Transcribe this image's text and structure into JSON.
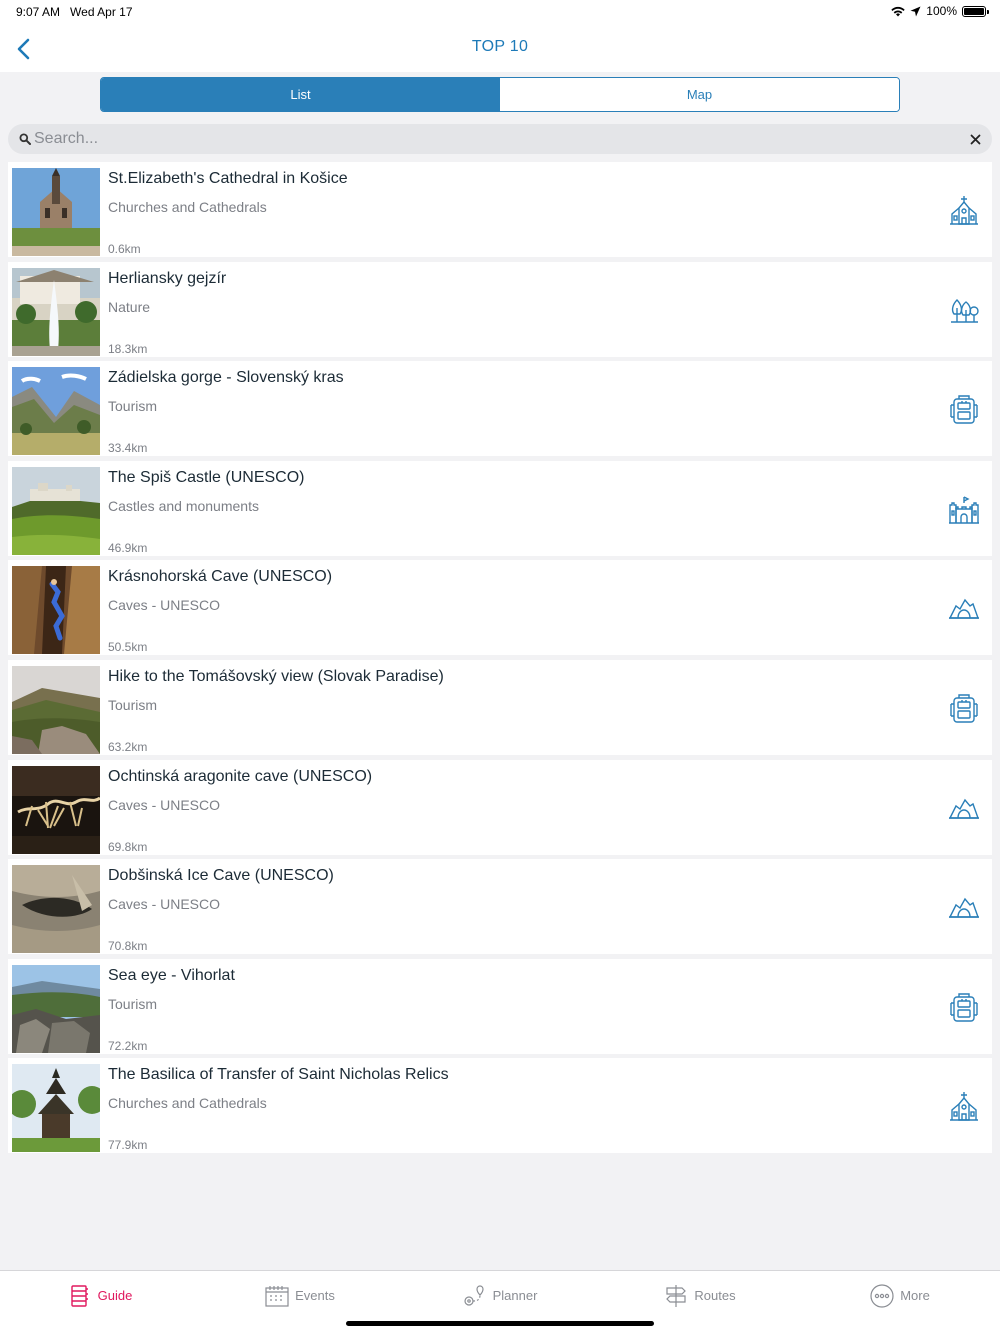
{
  "status_bar": {
    "time": "9:07 AM",
    "date": "Wed Apr 17",
    "battery": "100%"
  },
  "nav": {
    "title": "TOP 10",
    "back_icon": "chevron-left-icon"
  },
  "segments": {
    "list_label": "List",
    "map_label": "Map",
    "selected": "List"
  },
  "search": {
    "placeholder": "Search...",
    "value": ""
  },
  "colors": {
    "accent": "#2a7fb8",
    "tab_active": "#e0185e",
    "background": "#f2f2f4"
  },
  "items": [
    {
      "title": "St.Elizabeth's Cathedral in Košice",
      "category": "Churches and Cathedrals",
      "distance": "0.6km",
      "icon": "church-icon"
    },
    {
      "title": "Herliansky gejzír",
      "category": "Nature",
      "distance": "18.3km",
      "icon": "trees-icon"
    },
    {
      "title": "Zádielska gorge - Slovenský kras",
      "category": "Tourism",
      "distance": "33.4km",
      "icon": "backpack-icon"
    },
    {
      "title": "The Spiš Castle  (UNESCO)",
      "category": "Castles and monuments",
      "distance": "46.9km",
      "icon": "castle-icon"
    },
    {
      "title": "Krásnohorská Cave (UNESCO)",
      "category": "Caves - UNESCO",
      "distance": "50.5km",
      "icon": "cave-icon"
    },
    {
      "title": "Hike to the Tomášovský view  (Slovak Paradise)",
      "category": "Tourism",
      "distance": "63.2km",
      "icon": "backpack-icon"
    },
    {
      "title": "Ochtinská aragonite cave (UNESCO)",
      "category": "Caves - UNESCO",
      "distance": "69.8km",
      "icon": "cave-icon"
    },
    {
      "title": "Dobšinská Ice Cave (UNESCO)",
      "category": "Caves - UNESCO",
      "distance": "70.8km",
      "icon": "cave-icon"
    },
    {
      "title": "Sea eye - Vihorlat",
      "category": "Tourism",
      "distance": "72.2km",
      "icon": "backpack-icon"
    },
    {
      "title": "The Basilica of Transfer of Saint Nicholas Relics",
      "category": "Churches and Cathedrals",
      "distance": "77.9km",
      "icon": "church-icon"
    }
  ],
  "tabs": [
    {
      "label": "Guide",
      "icon": "guide-icon",
      "active": true
    },
    {
      "label": "Events",
      "icon": "calendar-icon",
      "active": false
    },
    {
      "label": "Planner",
      "icon": "planner-icon",
      "active": false
    },
    {
      "label": "Routes",
      "icon": "signpost-icon",
      "active": false
    },
    {
      "label": "More",
      "icon": "more-icon",
      "active": false
    }
  ]
}
